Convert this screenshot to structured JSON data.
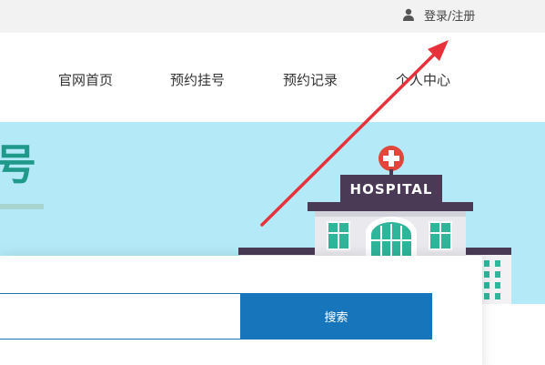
{
  "header": {
    "login_register": "登录/注册",
    "user_icon": "user-icon"
  },
  "nav": {
    "items": [
      {
        "label": "官网首页"
      },
      {
        "label": "预约挂号"
      },
      {
        "label": "预约记录"
      },
      {
        "label": "个人中心"
      }
    ]
  },
  "banner": {
    "title_char": "号",
    "hospital_sign": "HOSPITAL",
    "background_color": "#b4eaf7"
  },
  "search": {
    "input_value": "",
    "button_label": "搜索",
    "button_color": "#1776bb"
  },
  "annotation": {
    "arrow_color": "#e8323b"
  }
}
